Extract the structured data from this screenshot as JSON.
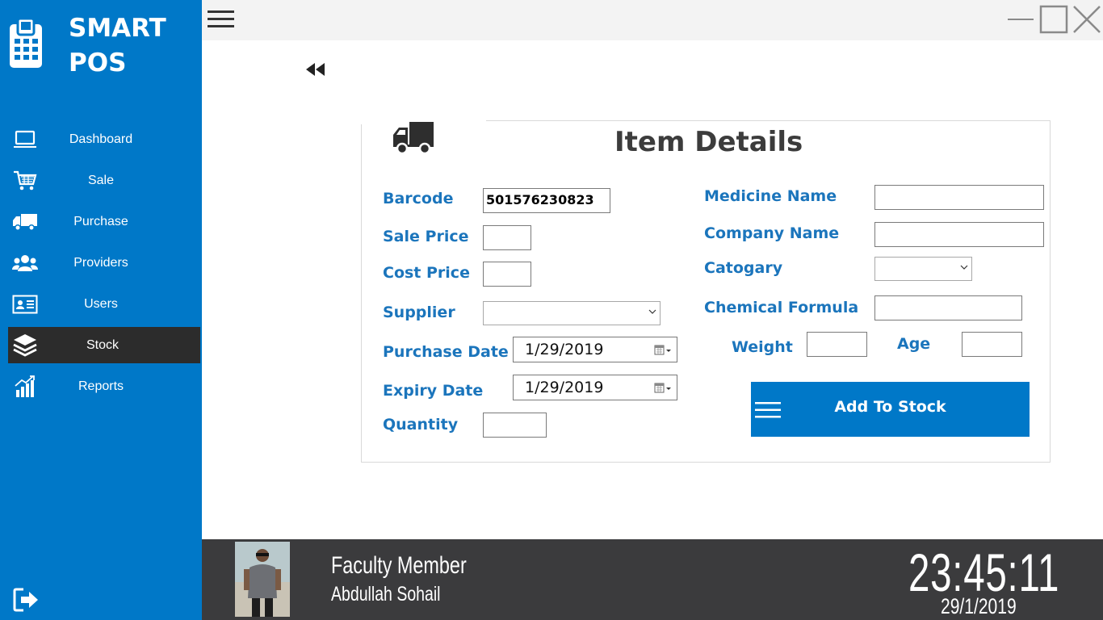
{
  "app": {
    "name_line1": "SMART",
    "name_line2": "POS"
  },
  "colors": {
    "sidebar": "#0078c8",
    "active_nav": "#2c2c2c",
    "label": "#1b75bc",
    "footer": "#3b3b3d",
    "button": "#0078c8"
  },
  "sidebar": {
    "items": [
      {
        "label": "Dashboard",
        "icon": "laptop-icon"
      },
      {
        "label": "Sale",
        "icon": "cart-icon"
      },
      {
        "label": "Purchase",
        "icon": "truck-icon"
      },
      {
        "label": "Providers",
        "icon": "users-group-icon"
      },
      {
        "label": "Users",
        "icon": "id-card-icon"
      },
      {
        "label": "Stock",
        "icon": "layers-icon",
        "active": true
      },
      {
        "label": "Reports",
        "icon": "bar-chart-icon"
      }
    ]
  },
  "form": {
    "title": "Item Details",
    "barcode_label": "Barcode",
    "barcode_value": "501576230823",
    "sale_price_label": "Sale Price",
    "cost_price_label": "Cost Price",
    "supplier_label": "Supplier",
    "purchase_date_label": "Purchase Date",
    "purchase_date_value": "1/29/2019",
    "expiry_date_label": "Expiry Date",
    "expiry_date_value": "1/29/2019",
    "quantity_label": "Quantity",
    "medicine_name_label": "Medicine Name",
    "company_name_label": "Company Name",
    "category_label": "Catogary",
    "chemical_formula_label": "Chemical Formula",
    "weight_label": "Weight",
    "age_label": "Age",
    "add_button_label": "Add To Stock"
  },
  "footer": {
    "role": "Faculty Member",
    "user_name": "Abdullah Sohail",
    "time": "23:45:11",
    "date": "29/1/2019"
  }
}
